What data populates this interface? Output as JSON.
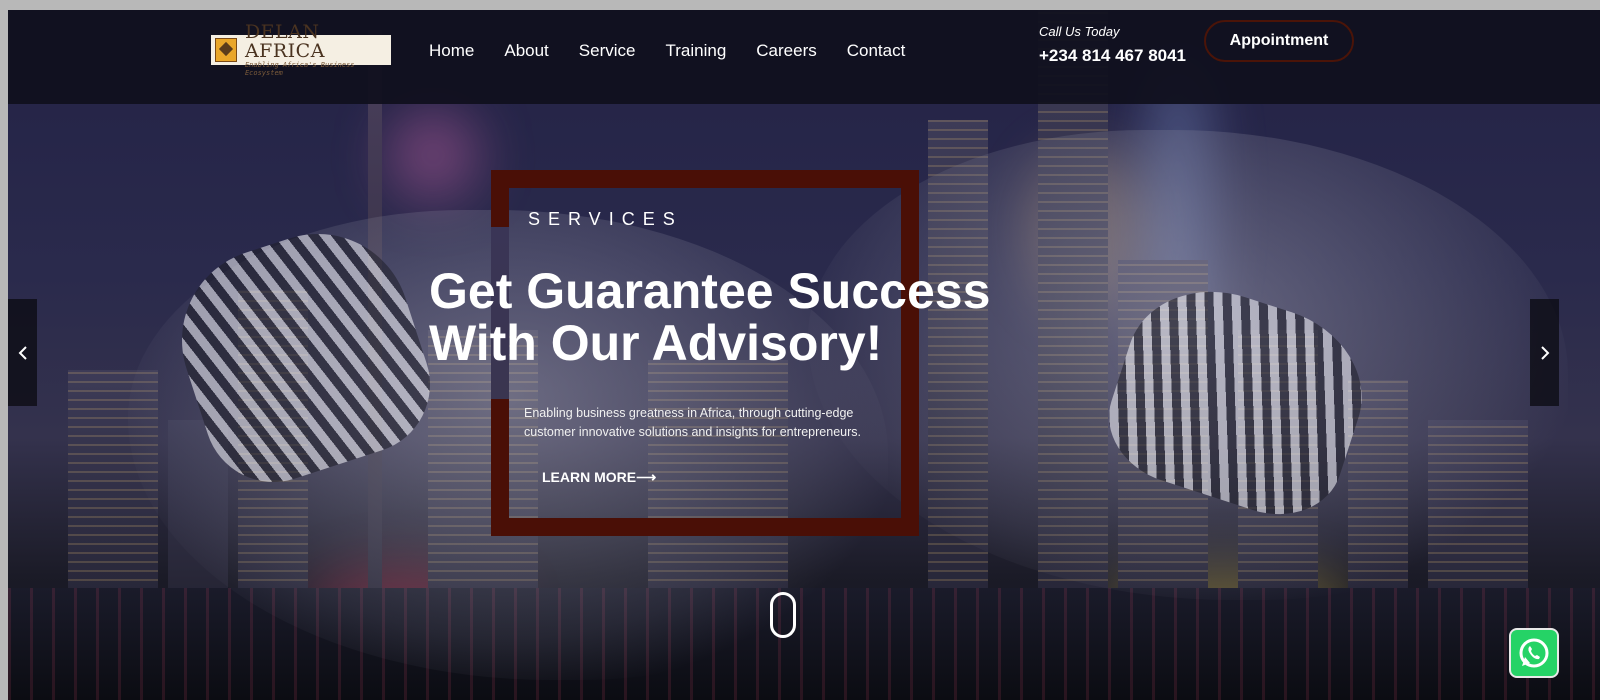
{
  "brand": {
    "name": "DELAN AFRICA",
    "tagline": "Enabling Africa's Business Ecosystem"
  },
  "nav": {
    "items": [
      "Home",
      "About",
      "Service",
      "Training",
      "Careers",
      "Contact"
    ]
  },
  "contact": {
    "label": "Call Us Today",
    "phone": "+234 814 467 8041"
  },
  "appointment": {
    "label": "Appointment"
  },
  "hero": {
    "eyebrow": "SERVICES",
    "headline_line1": "Get Guarantee Success",
    "headline_line2": "With Our Advisory!",
    "subtext": "Enabling business greatness in Africa, through cutting-edge customer innovative solutions and insights for entrepreneurs.",
    "cta": "LEARN MORE⟶"
  },
  "slider": {
    "prev_icon": "chevron-left-icon",
    "next_icon": "chevron-right-icon"
  },
  "colors": {
    "nav_bg": "#10101e",
    "frame_accent": "#4a0f06",
    "whatsapp": "#25d366"
  }
}
